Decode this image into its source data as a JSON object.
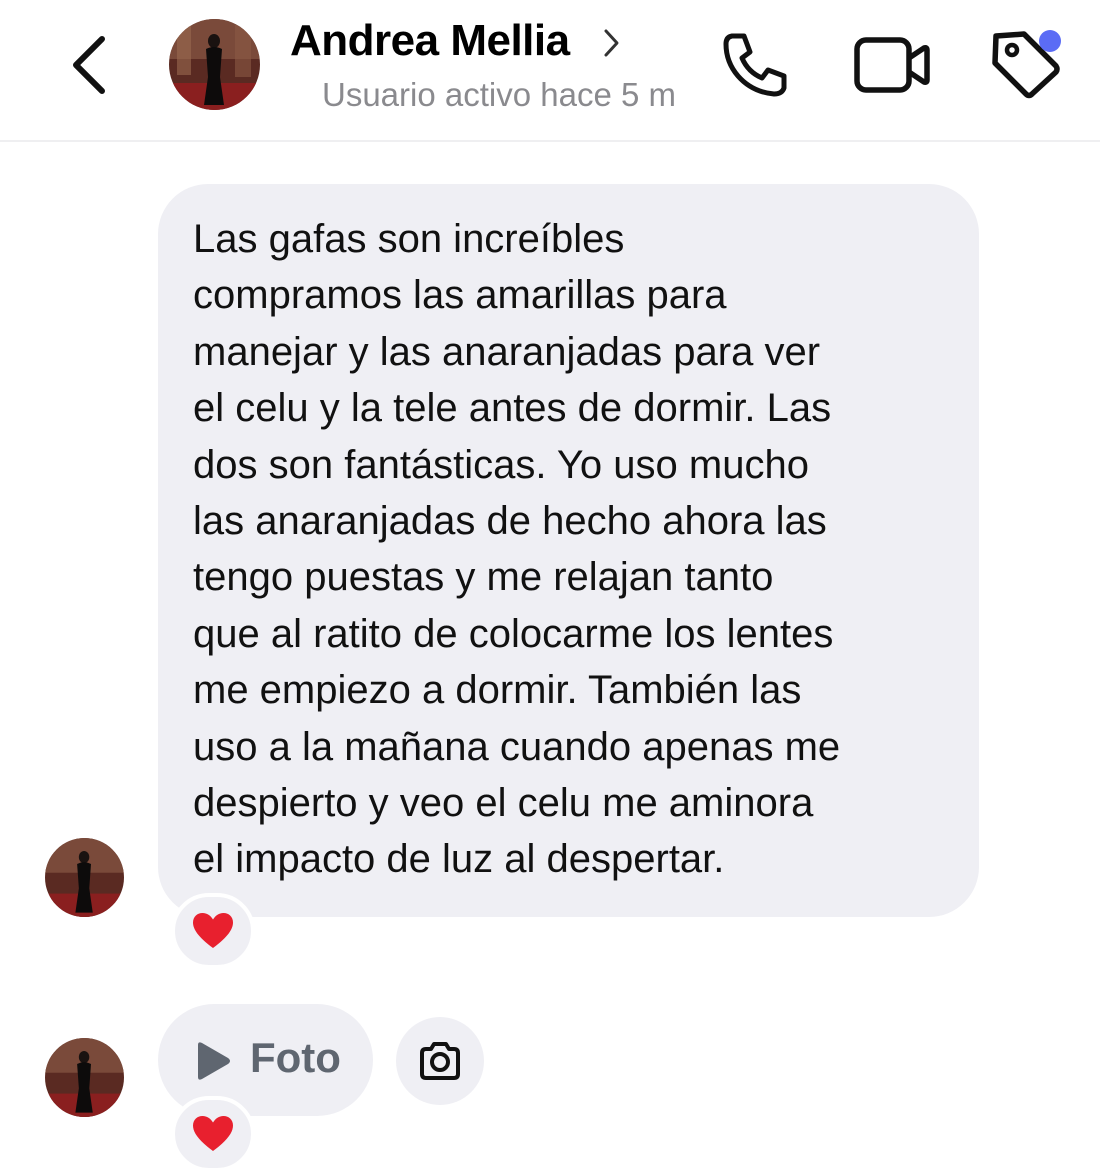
{
  "header": {
    "contact_name": "Andrea Mellia",
    "status": "Usuario activo hace 5 m"
  },
  "messages": [
    {
      "text": "Las gafas son increíbles compramos las amarillas para manejar y las anaranjadas para ver el celu y la tele antes de dormir. Las dos son fantásticas. Yo uso mucho las anaranjadas de hecho ahora las tengo puestas y me relajan tanto que al ratito de colocarme los lentes me empiezo a dormir. También las uso a la mañana cuando apenas me despierto y veo el celu me aminora el impacto de luz al despertar.",
      "lines": [
        "Las gafas son increíbles",
        "compramos las amarillas para",
        "manejar y las anaranjadas para ver",
        "el celu y la tele antes de dormir. Las",
        "dos son fantásticas. Yo uso mucho",
        "las anaranjadas de hecho ahora las",
        "tengo puestas y me relajan tanto",
        "que al ratito de colocarme los lentes",
        "me empiezo a dormir. También las",
        "uso a la mañana cuando apenas me",
        "despierto y veo el celu me aminora",
        "el impacto de luz al despertar."
      ],
      "reaction": "red-heart"
    },
    {
      "attachment_label": "Foto",
      "reaction": "red-heart"
    }
  ],
  "colors": {
    "bubble": "#efeff4",
    "status_text": "#8a8a8e",
    "notification_dot": "#5b6cf5",
    "heart": "#e8202e"
  },
  "icons": [
    "back-chevron-icon",
    "phone-icon",
    "video-camera-icon",
    "tag-icon",
    "play-icon",
    "camera-icon",
    "heart-icon"
  ]
}
